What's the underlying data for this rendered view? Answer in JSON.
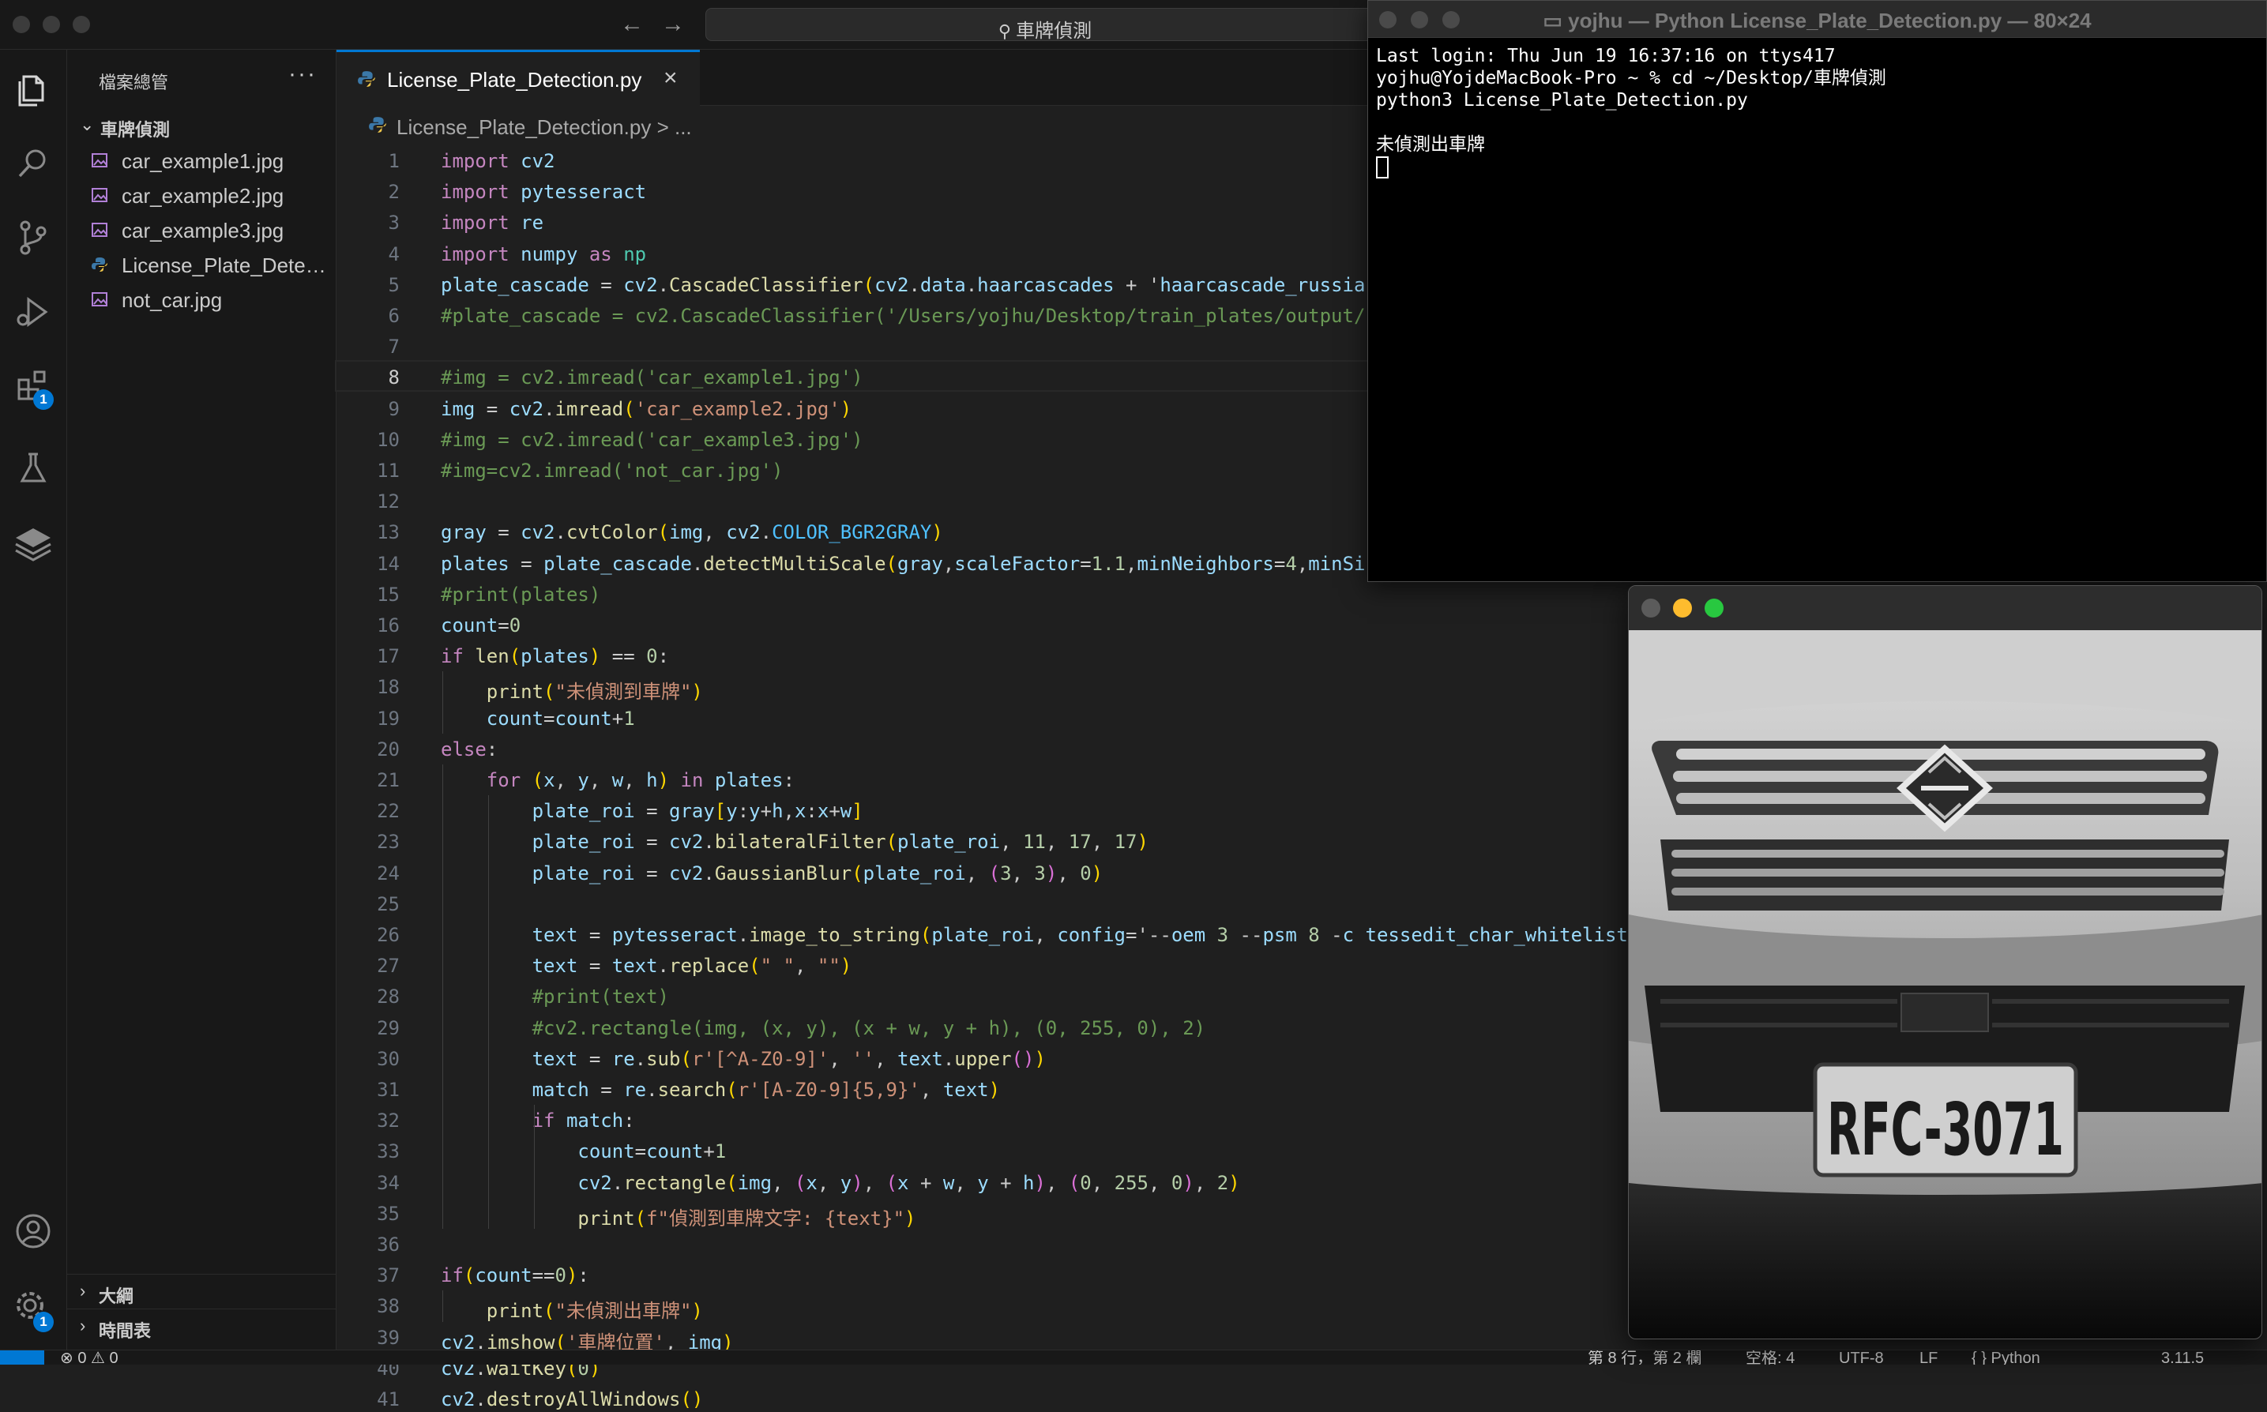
{
  "titlebar": {
    "search_text": "車牌偵測",
    "icons": [
      "back-arrow-icon",
      "forward-arrow-icon",
      "search-icon"
    ]
  },
  "activity_bar": {
    "icons": [
      "explorer-icon",
      "search-icon",
      "source-control-icon",
      "run-debug-icon",
      "extensions-icon",
      "testing-icon",
      "layers-icon",
      "account-icon",
      "settings-gear-icon"
    ],
    "extensions_badge": "1",
    "settings_badge": "1",
    "accent_color": "#0078d4"
  },
  "sidebar": {
    "header": "檔案總管",
    "more": "···",
    "folder": "車牌偵測",
    "files": [
      {
        "name": "car_example1.jpg",
        "icon": "image-file-icon"
      },
      {
        "name": "car_example2.jpg",
        "icon": "image-file-icon"
      },
      {
        "name": "car_example3.jpg",
        "icon": "image-file-icon"
      },
      {
        "name": "License_Plate_Detection.py",
        "icon": "python-file-icon"
      },
      {
        "name": "not_car.jpg",
        "icon": "image-file-icon"
      }
    ],
    "outline_label": "大綱",
    "timeline_label": "時間表"
  },
  "editor": {
    "tab_label": "License_Plate_Detection.py",
    "breadcrumb_file": "License_Plate_Detection.py",
    "breadcrumb_rest": "> ...",
    "current_line": 8,
    "line_numbers": [
      "1",
      "2",
      "3",
      "4",
      "5",
      "6",
      "7",
      "8",
      "9",
      "10",
      "11",
      "12",
      "13",
      "14",
      "15",
      "16",
      "17",
      "18",
      "19",
      "20",
      "21",
      "22",
      "23",
      "24",
      "25",
      "26",
      "27",
      "28",
      "29",
      "30",
      "31",
      "32",
      "33",
      "34",
      "35",
      "36",
      "37",
      "38",
      "39",
      "40",
      "41"
    ],
    "lines": [
      "import cv2",
      "import pytesseract",
      "import re",
      "import numpy as np",
      "plate_cascade = cv2.CascadeClassifier(cv2.data.haarcascades + 'haarcascade_russia",
      "#plate_cascade = cv2.CascadeClassifier('/Users/yojhu/Desktop/train_plates/output/",
      "",
      "#img = cv2.imread('car_example1.jpg')",
      "img = cv2.imread('car_example2.jpg')",
      "#img = cv2.imread('car_example3.jpg')",
      "#img=cv2.imread('not_car.jpg')",
      "",
      "gray = cv2.cvtColor(img, cv2.COLOR_BGR2GRAY)",
      "plates = plate_cascade.detectMultiScale(gray,scaleFactor=1.1,minNeighbors=4,minSi",
      "#print(plates)",
      "count=0",
      "if len(plates) == 0:",
      "    print(\"未偵測到車牌\")",
      "    count=count+1",
      "else:",
      "    for (x, y, w, h) in plates:",
      "        plate_roi = gray[y:y+h,x:x+w]",
      "        plate_roi = cv2.bilateralFilter(plate_roi, 11, 17, 17)",
      "        plate_roi = cv2.GaussianBlur(plate_roi, (3, 3), 0)",
      "",
      "        text = pytesseract.image_to_string(plate_roi, config='--oem 3 --psm 8 -c tessedit_char_whitelist",
      "        text = text.replace(\" \", \"\")",
      "        #print(text)",
      "        #cv2.rectangle(img, (x, y), (x + w, y + h), (0, 255, 0), 2)",
      "        text = re.sub(r'[^A-Z0-9]', '', text.upper())",
      "        match = re.search(r'[A-Z0-9]{5,9}', text)",
      "        if match:",
      "            count=count+1",
      "            cv2.rectangle(img, (x, y), (x + w, y + h), (0, 255, 0), 2)",
      "            print(f\"偵測到車牌文字: {text}\")",
      "",
      "if(count==0):",
      "    print(\"未偵測出車牌\")",
      "cv2.imshow('車牌位置', img)",
      "cv2.waitKey(0)",
      "cv2.destroyAllWindows()"
    ]
  },
  "statusbar": {
    "problems": "⊗ 0 ⚠ 0",
    "position": "第 8 行，第 2 欄",
    "spaces": "空格: 4",
    "encoding": "UTF-8",
    "eol": "LF",
    "language": "{ } Python",
    "python_version": "3.11.5"
  },
  "terminal": {
    "title": "yojhu — Python License_Plate_Detection.py — 80×24",
    "lines": [
      "Last login: Thu Jun 19 16:37:16 on ttys417",
      "yojhu@YojdeMacBook-Pro ~ % cd ~/Desktop/車牌偵測",
      "python3 License_Plate_Detection.py",
      "",
      "未偵測出車牌"
    ]
  },
  "image_window": {
    "plate_text": "RFC-3071",
    "colors": {
      "close": "#5b5b5b",
      "minimize": "#febc2e",
      "zoom": "#28c840"
    }
  }
}
